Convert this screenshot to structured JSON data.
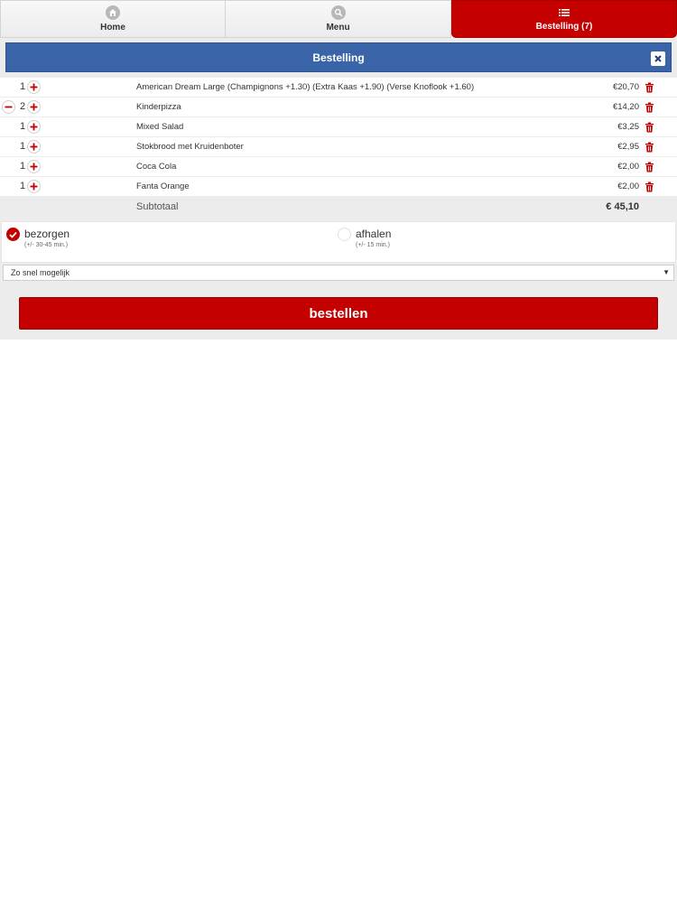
{
  "nav": {
    "home_label": "Home",
    "menu_label": "Menu",
    "order_label": "Bestelling (7)",
    "active_color": "#c40000"
  },
  "panel": {
    "title": "Bestelling",
    "close_icon": "close-icon"
  },
  "order": {
    "items": [
      {
        "qty": "1",
        "name": "American Dream Large (Champignons +1.30) (Extra Kaas +1.90) (Verse Knoflook +1.60)",
        "price": "€20,70"
      },
      {
        "qty": "2",
        "name": "Kinderpizza",
        "price": "€14,20"
      },
      {
        "qty": "1",
        "name": "Mixed Salad",
        "price": "€3,25"
      },
      {
        "qty": "1",
        "name": "Stokbrood met Kruidenboter",
        "price": "€2,95"
      },
      {
        "qty": "1",
        "name": "Coca Cola",
        "price": "€2,00"
      },
      {
        "qty": "1",
        "name": "Fanta Orange",
        "price": "€2,00"
      }
    ],
    "subtotal_label": "Subtotaal",
    "subtotal_value": "€ 45,10"
  },
  "delivery": {
    "options": [
      {
        "label": "bezorgen",
        "sub": "(+/- 30-45 min.)",
        "selected": true
      },
      {
        "label": "afhalen",
        "sub": "(+/- 15 min.)",
        "selected": false
      }
    ],
    "time_select": "Zo snel mogelijk"
  },
  "order_button": "bestellen",
  "colors": {
    "header_blue": "#3a64a8",
    "brand_red": "#c40000"
  }
}
